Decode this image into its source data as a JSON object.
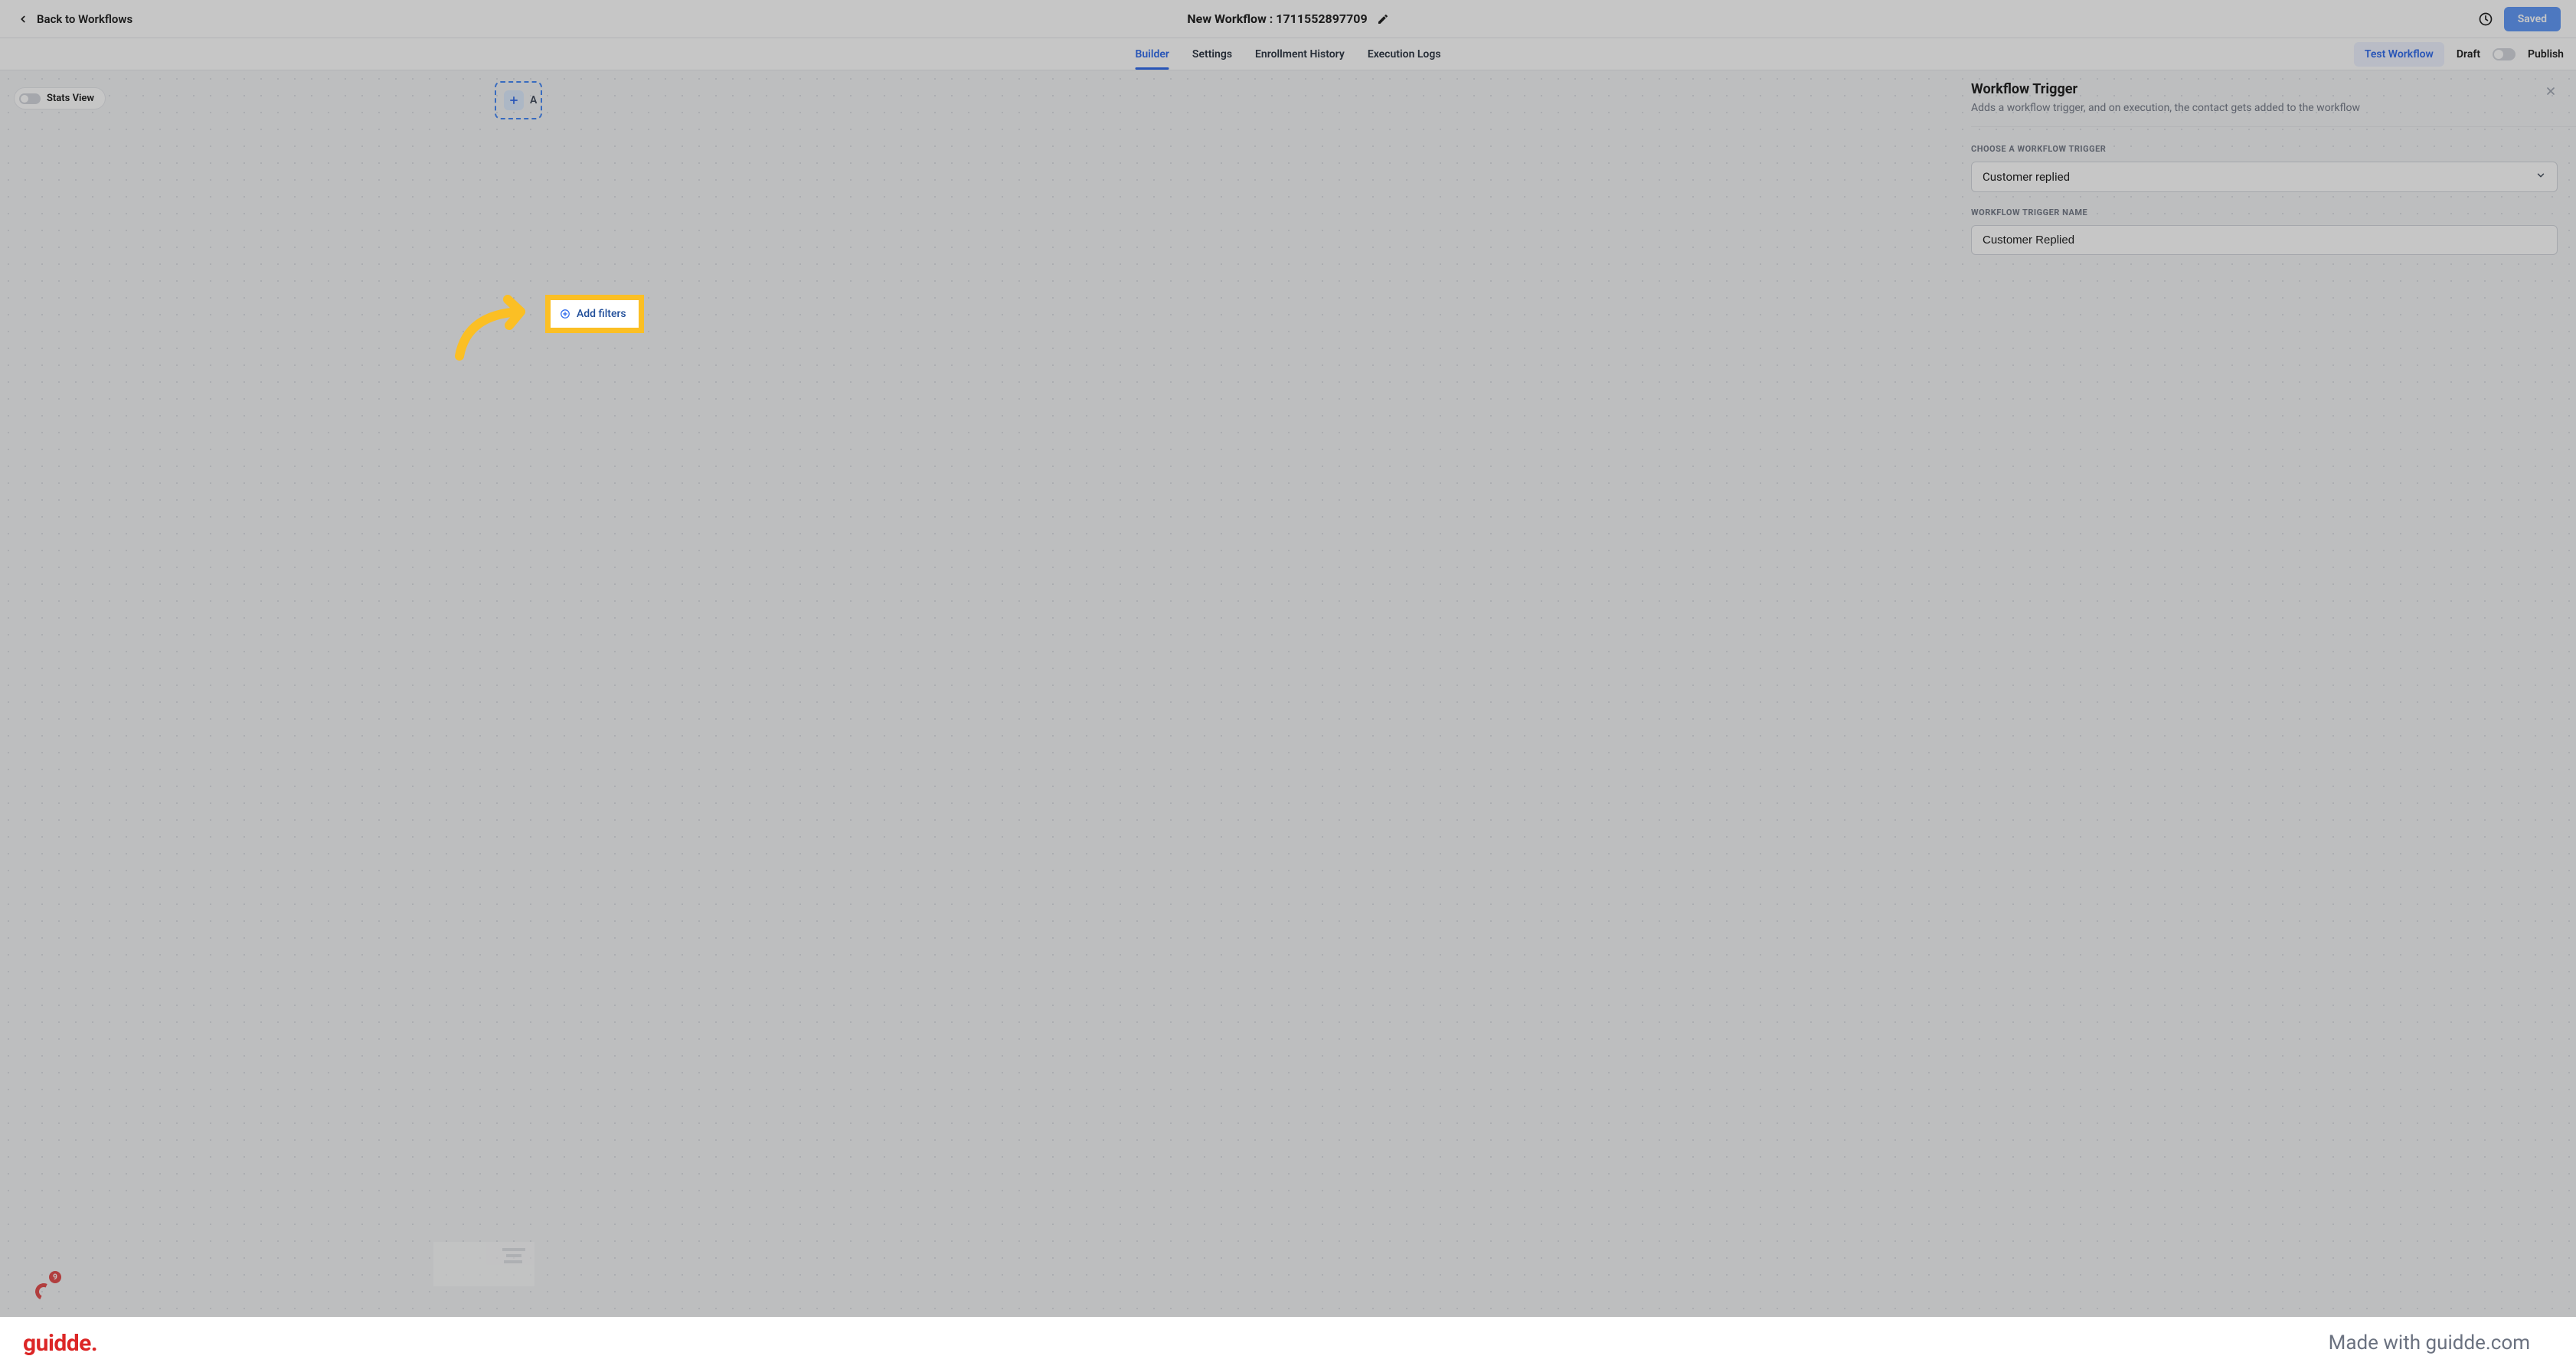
{
  "header": {
    "back_label": "Back to Workflows",
    "title": "New Workflow : 1711552897709",
    "saved_label": "Saved"
  },
  "tabs": {
    "items": [
      {
        "label": "Builder",
        "active": true
      },
      {
        "label": "Settings",
        "active": false
      },
      {
        "label": "Enrollment History",
        "active": false
      },
      {
        "label": "Execution Logs",
        "active": false
      }
    ],
    "test_label": "Test Workflow",
    "draft_label": "Draft",
    "publish_label": "Publish"
  },
  "canvas": {
    "stats_view_label": "Stats View",
    "trigger_node_letter": "A",
    "badge_count": "9"
  },
  "drawer": {
    "title": "Workflow Trigger",
    "subtitle": "Adds a workflow trigger, and on execution, the contact gets added to the workflow",
    "choose_label": "CHOOSE A WORKFLOW TRIGGER",
    "choose_value": "Customer replied",
    "name_label": "WORKFLOW TRIGGER NAME",
    "name_value": "Customer Replied",
    "add_filters_label": "Add filters"
  },
  "footer": {
    "logo_text": "guidde.",
    "made_with": "Made with guidde.com"
  }
}
